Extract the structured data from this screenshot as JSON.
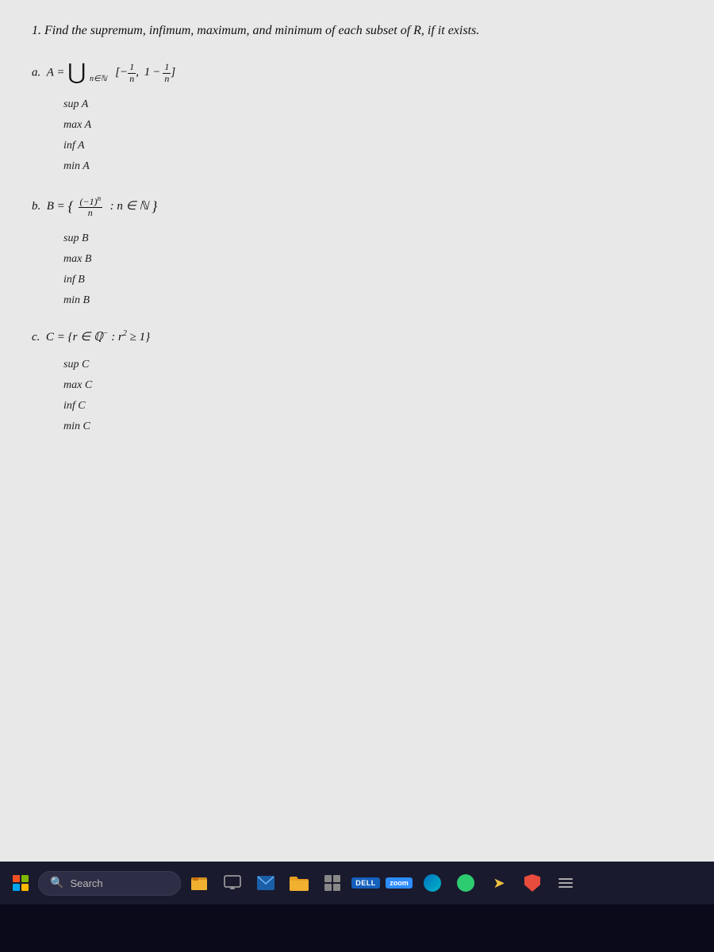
{
  "page": {
    "question_number": "1.",
    "question_text": "Find the supremum, infimum, maximum, and minimum of each subset of R, if it exists."
  },
  "problems": {
    "a": {
      "label": "a.",
      "set_name": "A",
      "formula_html": "A = ∪ [-1/n, 1 - 1/n]",
      "subscript": "n∈ℕ",
      "items": [
        {
          "label": "sup A"
        },
        {
          "label": "max A"
        },
        {
          "label": "inf A"
        },
        {
          "label": "min A"
        }
      ]
    },
    "b": {
      "label": "b.",
      "set_name": "B",
      "formula_display": "B = { (-1)ⁿ/n : n ∈ ℕ }",
      "items": [
        {
          "label": "sup B"
        },
        {
          "label": "max B"
        },
        {
          "label": "inf B"
        },
        {
          "label": "min B"
        }
      ]
    },
    "c": {
      "label": "c.",
      "set_name": "C",
      "formula_display": "C = {r ∈ ℚ⁻ : r² ≥ 1}",
      "items": [
        {
          "label": "sup C"
        },
        {
          "label": "max C"
        },
        {
          "label": "inf C"
        },
        {
          "label": "min C"
        }
      ]
    }
  },
  "taskbar": {
    "search_placeholder": "Search",
    "icons": [
      {
        "name": "file-explorer",
        "label": "File Explorer"
      },
      {
        "name": "monitor",
        "label": "Monitor"
      },
      {
        "name": "mail",
        "label": "Mail"
      },
      {
        "name": "folder",
        "label": "Folder"
      },
      {
        "name": "grid-app",
        "label": "Grid App"
      },
      {
        "name": "dell",
        "label": "DELL"
      },
      {
        "name": "zoom",
        "label": "zoom"
      },
      {
        "name": "edge",
        "label": "Edge"
      },
      {
        "name": "green-app",
        "label": "Green App"
      },
      {
        "name": "yellow-arrow",
        "label": "Arrow App"
      },
      {
        "name": "shield",
        "label": "Shield App"
      },
      {
        "name": "menu",
        "label": "Menu"
      }
    ]
  }
}
